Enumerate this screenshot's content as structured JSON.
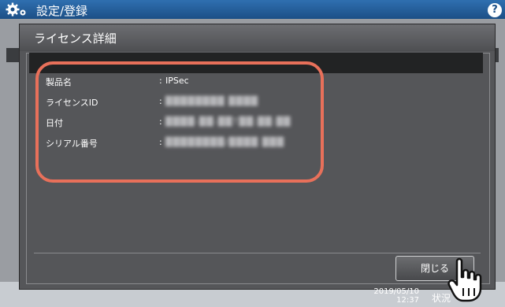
{
  "screen": {
    "title": "設定/登録",
    "help_label": "?"
  },
  "dialog": {
    "title": "ライセンス詳細",
    "separator": ":",
    "rows": [
      {
        "label": "製品名",
        "value": "IPSec"
      },
      {
        "label": "ライセンスID",
        "value": "████████ ████"
      },
      {
        "label": "日付",
        "value": "████-██-██T██:██:██"
      },
      {
        "label": "シリアル番号",
        "value": "████████/████ ███"
      }
    ],
    "close_label": "閉じる"
  },
  "status_bar": {
    "date": "2019/05/10",
    "time": "12:37",
    "status_label": "状況"
  },
  "colors": {
    "highlight": "#e8705a",
    "title_bar": "#1c4f86"
  }
}
